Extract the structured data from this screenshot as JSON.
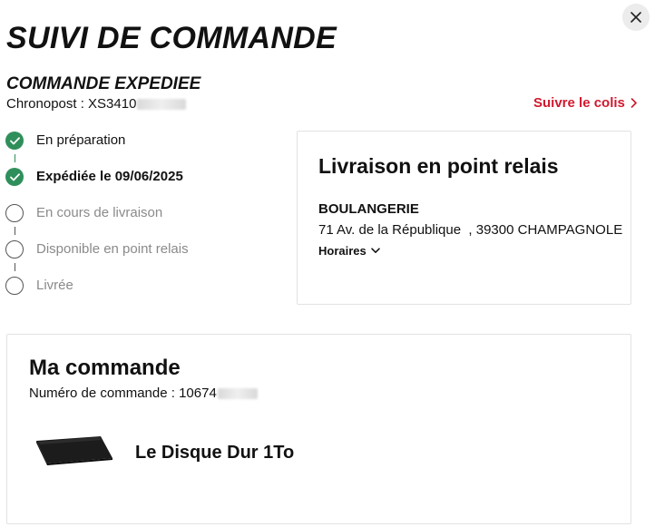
{
  "header": {
    "title": "SUIVI DE COMMANDE",
    "close_label": "Fermer"
  },
  "shipment": {
    "status_title": "COMMANDE EXPEDIEE",
    "carrier_prefix": "Chronopost : XS3410",
    "track_link": "Suivre le colis"
  },
  "timeline": {
    "steps": [
      {
        "label": "En préparation",
        "state": "done"
      },
      {
        "label": "Expédiée le 09/06/2025",
        "state": "current"
      },
      {
        "label": "En cours de livraison",
        "state": "todo"
      },
      {
        "label": "Disponible en point relais",
        "state": "todo"
      },
      {
        "label": "Livrée",
        "state": "todo"
      }
    ]
  },
  "delivery": {
    "title": "Livraison en point relais",
    "shop_name": "BOULANGERIE",
    "address": "71 Av. de la République  , 39300 CHAMPAGNOLE",
    "hours_label": "Horaires"
  },
  "order": {
    "title": "Ma commande",
    "number_prefix": "Numéro de commande : 10674",
    "product_name": "Le Disque Dur 1To"
  },
  "colors": {
    "accent_red": "#d1192f",
    "success_green": "#2f8f5b",
    "muted_grey": "#8a8a8a"
  },
  "icons": {
    "close": "close-icon",
    "chevron_right": "chevron-right-icon",
    "chevron_down": "chevron-down-icon",
    "check": "check-icon"
  }
}
